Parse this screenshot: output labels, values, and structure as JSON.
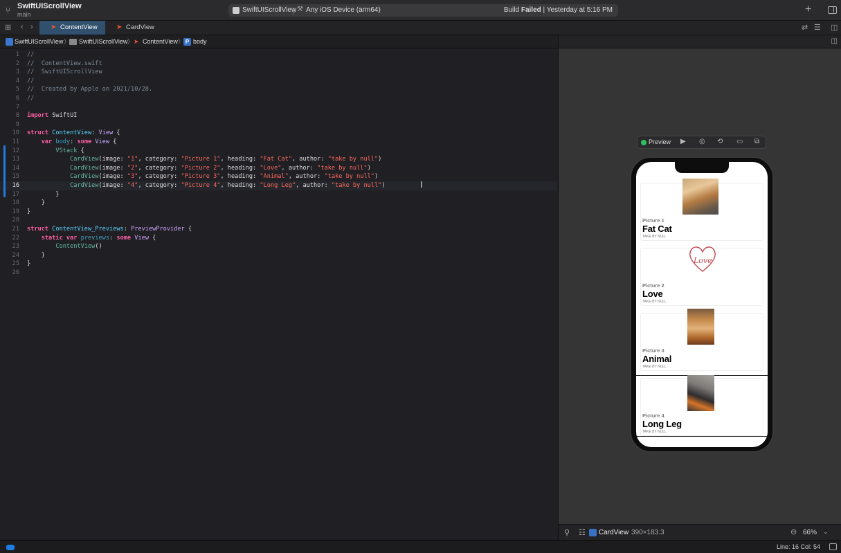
{
  "window": {
    "project_title": "SwiftUIScrollView",
    "branch": "main",
    "scheme": "SwiftUIScrollView",
    "device": "Any iOS Device (arm64)",
    "build_label": "Build",
    "build_status": "Failed",
    "build_time": "| Yesterday at 5:16 PM"
  },
  "tabs": [
    {
      "label": "ContentView",
      "active": true
    },
    {
      "label": "CardView",
      "active": false
    }
  ],
  "jumpbar": {
    "project": "SwiftUIScrollView",
    "folder": "SwiftUIScrollView",
    "file": "ContentView",
    "symbol_badge": "P",
    "symbol": "body"
  },
  "editor": {
    "lines": [
      {
        "n": "1",
        "html": "<span class=\"cm\">//</span>"
      },
      {
        "n": "2",
        "html": "<span class=\"cm\">//  ContentView.swift</span>"
      },
      {
        "n": "3",
        "html": "<span class=\"cm\">//  SwiftUIScrollView</span>"
      },
      {
        "n": "4",
        "html": "<span class=\"cm\">//</span>"
      },
      {
        "n": "5",
        "html": "<span class=\"cm\">//  Created by Apple on 2021/10/28.</span>"
      },
      {
        "n": "6",
        "html": "<span class=\"cm\">//</span>"
      },
      {
        "n": "7",
        "html": ""
      },
      {
        "n": "8",
        "html": "<span class=\"kw\">import</span> SwiftUI"
      },
      {
        "n": "9",
        "html": ""
      },
      {
        "n": "10",
        "html": "<span class=\"kw\">struct</span> <span class=\"ty\">ContentView</span>: <span class=\"tyd\">View</span> {"
      },
      {
        "n": "11",
        "html": "    <span class=\"kw\">var</span> <span class=\"prop\">body</span>: <span class=\"kw\">some</span> <span class=\"tyd\">View</span> {"
      },
      {
        "n": "12",
        "html": "        <span class=\"fn\">VStack</span> {"
      },
      {
        "n": "13",
        "html": "            <span class=\"fn\">CardView</span>(image: <span class=\"str\">\"1\"</span>, category: <span class=\"str\">\"Picture 1\"</span>, heading: <span class=\"str\">\"Fat Cat\"</span>, author: <span class=\"str\">\"take by null\"</span>)"
      },
      {
        "n": "14",
        "html": "            <span class=\"fn\">CardView</span>(image: <span class=\"str\">\"2\"</span>, category: <span class=\"str\">\"Picture 2\"</span>, heading: <span class=\"str\">\"Love\"</span>, author: <span class=\"str\">\"take by null\"</span>)"
      },
      {
        "n": "15",
        "html": "            <span class=\"fn\">CardView</span>(image: <span class=\"str\">\"3\"</span>, category: <span class=\"str\">\"Picture 3\"</span>, heading: <span class=\"str\">\"Animal\"</span>, author: <span class=\"str\">\"take by null\"</span>)"
      },
      {
        "n": "16",
        "html": "            <span class=\"fn\">CardView</span>(image: <span class=\"str\">\"4\"</span>, category: <span class=\"str\">\"Picture 4\"</span>, heading: <span class=\"str\">\"Long Leg\"</span>, author: <span class=\"str\">\"take by null\"</span>)",
        "active": true
      },
      {
        "n": "17",
        "html": "        }"
      },
      {
        "n": "18",
        "html": "    }"
      },
      {
        "n": "19",
        "html": "}"
      },
      {
        "n": "20",
        "html": ""
      },
      {
        "n": "21",
        "html": "<span class=\"kw\">struct</span> <span class=\"ty\">ContentView_Previews</span>: <span class=\"tyd\">PreviewProvider</span> {"
      },
      {
        "n": "22",
        "html": "    <span class=\"kw\">static var</span> <span class=\"prop\">previews</span>: <span class=\"kw\">some</span> <span class=\"tyd\">View</span> {"
      },
      {
        "n": "23",
        "html": "        <span class=\"fn\">ContentView</span>()"
      },
      {
        "n": "24",
        "html": "    }"
      },
      {
        "n": "25",
        "html": "}"
      },
      {
        "n": "26",
        "html": ""
      }
    ]
  },
  "preview": {
    "label": "Preview",
    "cards": [
      {
        "category": "Picture 1",
        "heading": "Fat Cat",
        "author": "take by null",
        "image": "cat-photo"
      },
      {
        "category": "Picture 2",
        "heading": "Love",
        "author": "take by null",
        "image": "heart-drawing"
      },
      {
        "category": "Picture 3",
        "heading": "Animal",
        "author": "take by null",
        "image": "alpaca-photo"
      },
      {
        "category": "Picture 4",
        "heading": "Long Leg",
        "author": "take by null",
        "image": "legs-photo"
      }
    ]
  },
  "canvas_footer": {
    "component": "CardView",
    "size": "390×183.3",
    "zoom": "66%"
  },
  "statusbar": {
    "cursor": "Line: 16  Col: 54"
  }
}
